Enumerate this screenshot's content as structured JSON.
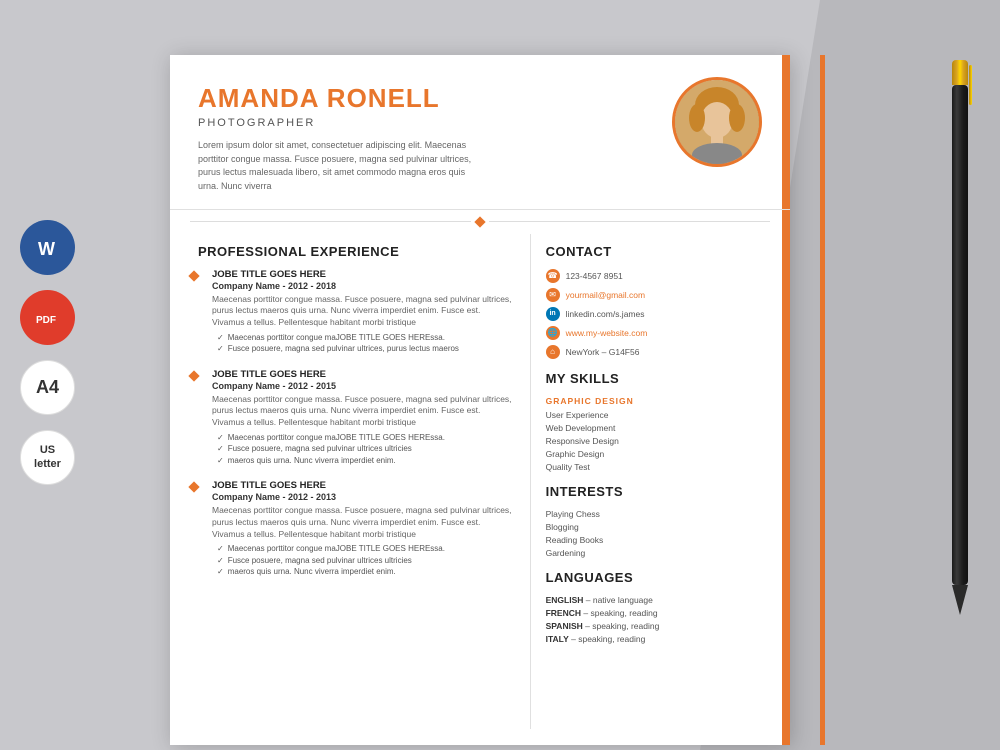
{
  "background": {
    "main": "#c8c8cc"
  },
  "left_icons": {
    "word_label": "W",
    "pdf_label": "PDF",
    "a4_label": "A4",
    "us_label": "US\nletter"
  },
  "header": {
    "name": "AMANDA RONELL",
    "title": "PHOTOGRAPHER",
    "summary": "Lorem ipsum dolor sit amet, consectetuer adipiscing elit. Maecenas porttitor congue massa. Fusce posuere, magna sed pulvinar ultrices, purus lectus malesuada libero, sit amet commodo magna eros quis urna. Nunc viverra"
  },
  "experience": {
    "section_title": "PROFESSIONAL EXPERIENCE",
    "items": [
      {
        "job_title": "JOBE TITLE GOES HERE",
        "company": "Company Name  - 2012 - 2018",
        "description": "Maecenas porttitor congue massa. Fusce posuere, magna sed pulvinar ultrices, purus lectus maeros quis urna. Nunc viverra imperdiet enim. Fusce est. Vivamus a tellus. Pellentesque habitant morbi tristique",
        "bullets": [
          "Maecenas porttitor congue maJOBE TITLE GOES HEREssa.",
          "Fusce posuere, magna sed pulvinar ultrices, purus lectus maeros"
        ]
      },
      {
        "job_title": "JOBE TITLE GOES HERE",
        "company": "Company Name  - 2012 - 2015",
        "description": "Maecenas porttitor congue massa. Fusce posuere, magna sed pulvinar ultrices, purus lectus maeros quis urna. Nunc viverra imperdiet enim. Fusce est. Vivamus a tellus. Pellentesque habitant morbi tristique",
        "bullets": [
          "Maecenas porttitor congue maJOBE TITLE GOES HEREssa.",
          "Fusce posuere, magna sed pulvinar ultrices ultricies",
          "maeros quis urna. Nunc viverra imperdiet enim."
        ]
      },
      {
        "job_title": "JOBE TITLE GOES HERE",
        "company": "Company Name  - 2012 - 2013",
        "description": "Maecenas porttitor congue massa. Fusce posuere, magna sed pulvinar ultrices, purus lectus maeros quis urna. Nunc viverra imperdiet enim. Fusce est. Vivamus a tellus. Pellentesque habitant morbi tristique",
        "bullets": [
          "Maecenas porttitor congue maJOBE TITLE GOES HEREssa.",
          "Fusce posuere, magna sed pulvinar ultrices ultricies",
          "maeros quis urna. Nunc viverra imperdiet enim."
        ]
      }
    ]
  },
  "contact": {
    "section_title": "CONTACT",
    "phone": "123-4567 8951",
    "email": "yourmail@gmail.com",
    "linkedin": "linkedin.com/s.james",
    "website": "www.my-website.com",
    "address": "NewYork – G14F56"
  },
  "skills": {
    "section_title": "MY SKILLS",
    "top_skill": "GRAPHIC DESIGN",
    "items": [
      "User Experience",
      "Web Development",
      "Responsive Design",
      "Graphic Design",
      "Quality Test"
    ]
  },
  "interests": {
    "section_title": "INTERESTS",
    "items": [
      "Playing Chess",
      "Blogging",
      "Reading Books",
      "Gardening"
    ]
  },
  "languages": {
    "section_title": "LANGUAGES",
    "items": [
      {
        "name": "ENGLISH",
        "level": "native language"
      },
      {
        "name": "FRENCH",
        "level": "speaking, reading"
      },
      {
        "name": "SPANISH",
        "level": "speaking, reading"
      },
      {
        "name": "ITALY",
        "level": "speaking, reading"
      }
    ]
  }
}
